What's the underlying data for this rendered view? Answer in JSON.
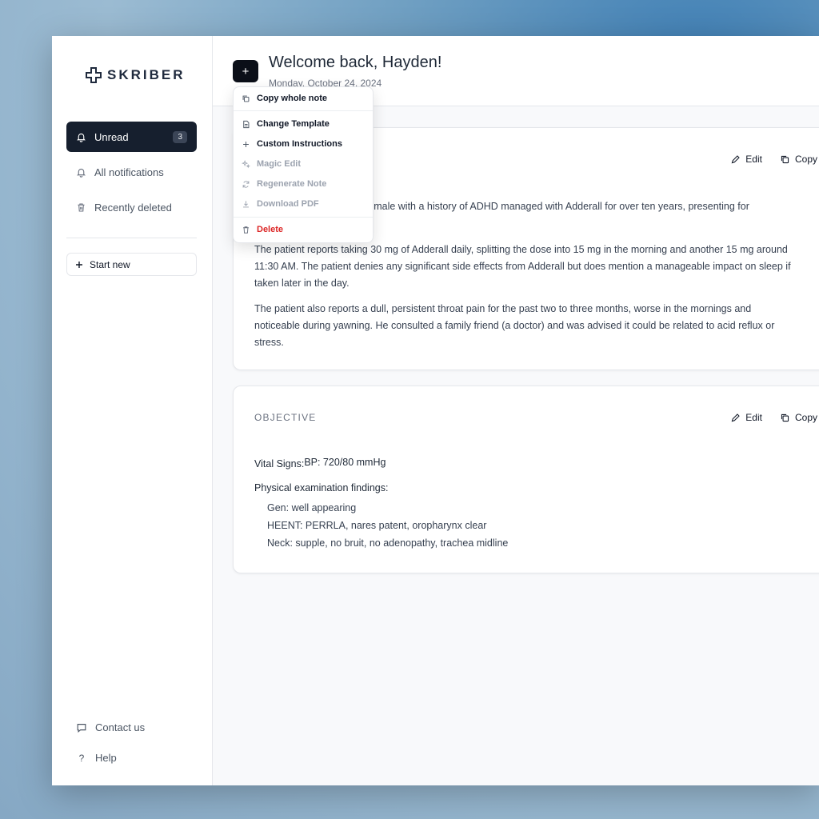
{
  "app": {
    "logo_text": "SKRIBER"
  },
  "sidebar": {
    "items": [
      {
        "label": "Unread",
        "badge": "3",
        "icon": "bell-icon",
        "active": true
      },
      {
        "label": "All notifications",
        "icon": "bell-icon"
      },
      {
        "label": "Recently deleted",
        "icon": "trash-icon"
      }
    ],
    "start_new": "Start new",
    "footer": [
      {
        "label": "Contact us",
        "icon": "chat-icon"
      },
      {
        "label": "Help",
        "icon": "question-icon"
      }
    ]
  },
  "header": {
    "plus_label": "+",
    "welcome": "Welcome back, Hayden!",
    "date": "Monday, October 24, 2024"
  },
  "menu": {
    "items": [
      {
        "label": "Copy whole note",
        "icon": "copy-icon",
        "state": "normal"
      },
      {
        "label": "Change Template",
        "icon": "document-icon",
        "state": "normal"
      },
      {
        "label": "Custom Instructions",
        "icon": "plus-icon",
        "state": "normal"
      },
      {
        "label": "Magic Edit",
        "icon": "sparkle-icon",
        "state": "disabled"
      },
      {
        "label": "Regenerate Note",
        "icon": "refresh-icon",
        "state": "disabled"
      },
      {
        "label": "Download PDF",
        "icon": "download-icon",
        "state": "disabled"
      },
      {
        "label": "Delete",
        "icon": "trash-icon",
        "state": "danger"
      }
    ]
  },
  "subjective": {
    "edit_label": "Edit",
    "copy_label": "Copy",
    "paragraphs": [
      "ld male with a history of ADHD managed with Adderall for over ten years, presenting for",
      "The patient reports taking 30 mg of Adderall daily, splitting the dose into 15 mg in the morning and another 15 mg around 11:30 AM. The patient denies any significant side effects from Adderall but does mention a manageable impact on sleep if taken later in the day.",
      "The patient also reports a dull, persistent throat pain for the past two to three months, worse in the mornings and noticeable during yawning. He consulted a family friend (a doctor) and was advised it could be related to acid reflux or stress."
    ]
  },
  "objective": {
    "title": "OBJECTIVE",
    "edit_label": "Edit",
    "copy_label": "Copy",
    "vitals_label": "Vital Signs:",
    "vitals_value": "BP: 720/80 mmHg",
    "exam_label": "Physical examination findings:",
    "findings": [
      "Gen: well appearing",
      "HEENT: PERRLA, nares patent, oropharynx clear",
      "Neck: supple, no bruit, no adenopathy, trachea midline"
    ]
  },
  "colors": {
    "sidebar_active": "#161f2e",
    "danger": "#dc2626",
    "disabled": "#9ca3af"
  }
}
